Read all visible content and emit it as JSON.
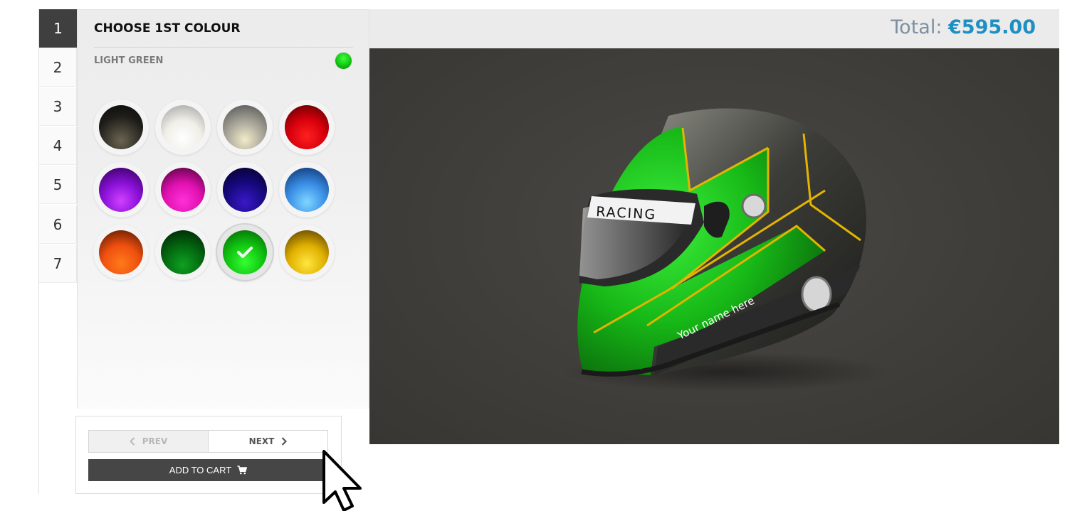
{
  "steps": [
    "1",
    "2",
    "3",
    "4",
    "5",
    "6",
    "7"
  ],
  "active_step": "1",
  "panel": {
    "title": "CHOOSE 1ST COLOUR",
    "selected_colour": "LIGHT GREEN",
    "selected_colour_hex": "#11c611"
  },
  "swatches": [
    {
      "name": "black",
      "hex": "#1a1a1a"
    },
    {
      "name": "white",
      "hex": "#f2f2f2"
    },
    {
      "name": "silver",
      "hex": "#9a9a9a"
    },
    {
      "name": "red",
      "hex": "#d9000f"
    },
    {
      "name": "purple",
      "hex": "#8a10d8"
    },
    {
      "name": "pink",
      "hex": "#e010b0"
    },
    {
      "name": "dark-blue",
      "hex": "#15087a"
    },
    {
      "name": "light-blue",
      "hex": "#3a8fe6"
    },
    {
      "name": "orange",
      "hex": "#f0500f"
    },
    {
      "name": "dark-green",
      "hex": "#036a10"
    },
    {
      "name": "light-green",
      "hex": "#11c611",
      "selected": true
    },
    {
      "name": "yellow",
      "hex": "#e0b000"
    }
  ],
  "controls": {
    "prev_label": "PREV",
    "next_label": "NEXT",
    "cart_label": "ADD TO CART"
  },
  "summary": {
    "total_label": "Total:",
    "total_value": "€595.00"
  },
  "helmet": {
    "visor_text": "RACING",
    "name_text": "Your name here",
    "primary_colour": "#1bbf1b",
    "stripe_colour": "#e3b400"
  },
  "colors": {
    "accent": "#1e8fc3",
    "dark_button": "#464646"
  }
}
